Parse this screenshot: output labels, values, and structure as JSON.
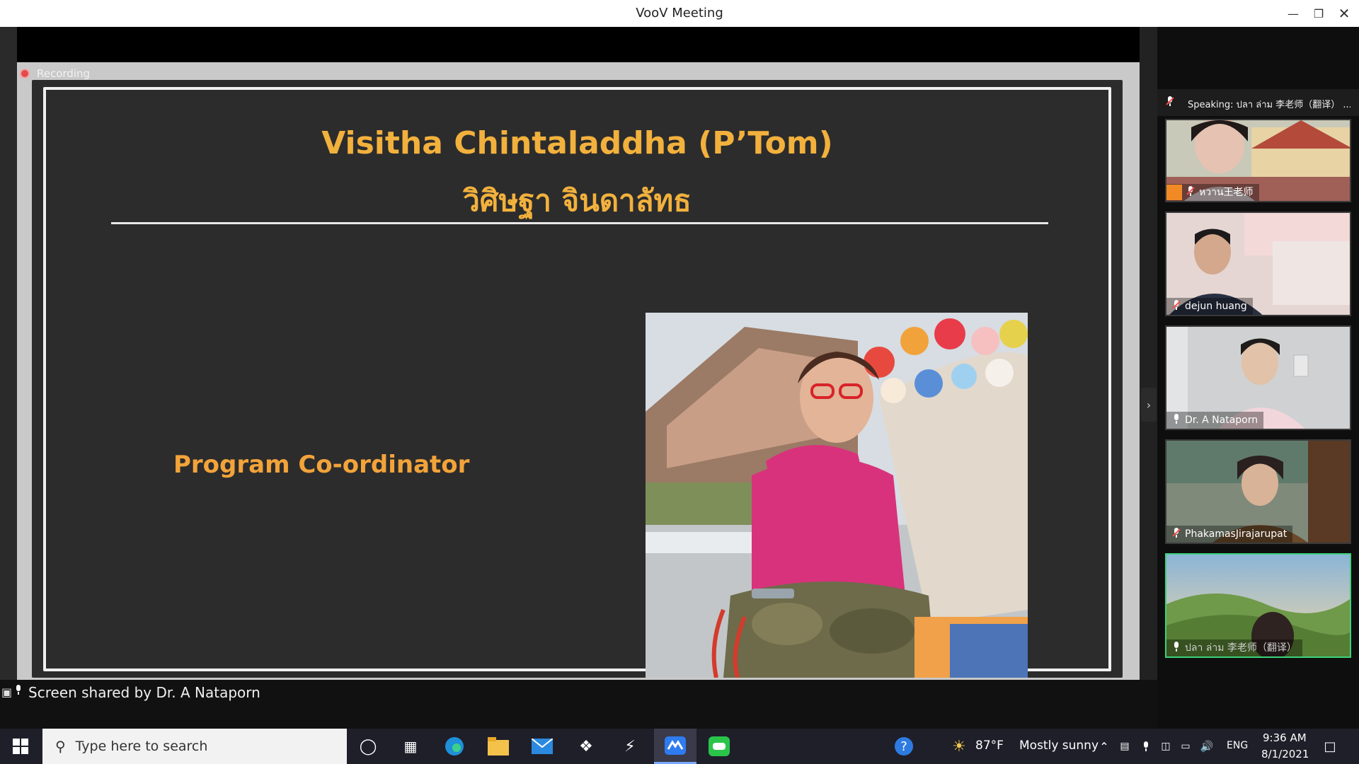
{
  "window": {
    "title": "VooV Meeting",
    "controls": [
      "minimize",
      "restore",
      "close"
    ]
  },
  "recording": {
    "label": "Recording"
  },
  "slide": {
    "name_en": "Visitha Chintaladdha (P’Tom)",
    "name_th": "วิศิษฐา จินดาลัทธ",
    "role": "Program Co-ordinator"
  },
  "sharebar": {
    "label": "Screen shared by Dr. A Nataporn"
  },
  "panel": {
    "speaking": "Speaking: ปลา ล่าม 李老师（翻译） ...",
    "participants": [
      {
        "name": "หวาน王老师",
        "muted": true
      },
      {
        "name": "dejun huang",
        "muted": true
      },
      {
        "name": "Dr. A Nataporn",
        "muted": false
      },
      {
        "name": "PhakamasJirajarupat",
        "muted": true
      },
      {
        "name": "ปลา ล่าม 李老师（翻译）",
        "muted": false
      }
    ]
  },
  "taskbar": {
    "search_placeholder": "Type here to search",
    "apps": [
      "start-icon",
      "cortana-icon",
      "task-view-icon",
      "edge-icon",
      "file-explorer-icon",
      "mail-icon",
      "dropbox-icon",
      "app-icon",
      "voov-icon",
      "line-icon"
    ],
    "help": "?",
    "weather": {
      "temp": "87°F",
      "condition": "Mostly sunny"
    },
    "lang": "ENG",
    "time": "9:36 AM",
    "date": "8/1/2021"
  }
}
